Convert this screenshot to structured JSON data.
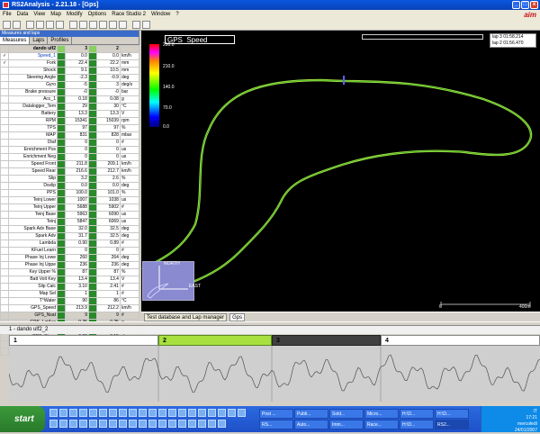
{
  "window": {
    "title": "RS2Analysis  -  2.21.18  -  [Gps]",
    "min": "_",
    "max": "□",
    "close": "x"
  },
  "menu": [
    "File",
    "Data",
    "View",
    "Map",
    "Modify",
    "Options",
    "Race Studio 2",
    "Window",
    "?"
  ],
  "brand": "aim",
  "left_panel": {
    "header": "Measures and laps",
    "tabs": [
      "Measures",
      "Laps",
      "Profiles"
    ],
    "columns": {
      "name": "dando ulf2",
      "lap_a": "3",
      "lap_b": "2"
    },
    "rows": [
      {
        "check": "✓",
        "name": "Speed_1",
        "a": "0.0",
        "b": "0.0",
        "unit": "km/h"
      },
      {
        "check": "✓",
        "name": "Fork",
        "a": "22.4",
        "b": "22.2",
        "unit": "mm"
      },
      {
        "check": "",
        "name": "Shock",
        "a": "9.1",
        "b": "10.5",
        "unit": "mm"
      },
      {
        "check": "",
        "name": "Steering Angle",
        "a": "-2.3",
        "b": "-0.9",
        "unit": "deg"
      },
      {
        "check": "",
        "name": "Gyro",
        "a": "-5",
        "b": "3",
        "unit": "deg/s"
      },
      {
        "check": "",
        "name": "Brake pressure",
        "a": "-0",
        "b": "-0",
        "unit": "bar"
      },
      {
        "check": "",
        "name": "Acc_1",
        "a": "0.18",
        "b": "0.08",
        "unit": "g"
      },
      {
        "check": "",
        "name": "Datalogger_Tem",
        "a": "29",
        "b": "30",
        "unit": "°C"
      },
      {
        "check": "",
        "name": "Battery",
        "a": "13.3",
        "b": "13.3",
        "unit": "V"
      },
      {
        "check": "",
        "name": "RPM",
        "a": "15341",
        "b": "15039",
        "unit": "rpm"
      },
      {
        "check": "",
        "name": "TPS",
        "a": "97",
        "b": "97",
        "unit": "%"
      },
      {
        "check": "",
        "name": "MAP",
        "a": "831",
        "b": "828",
        "unit": "mbar"
      },
      {
        "check": "",
        "name": "Dtaf",
        "a": "0",
        "b": "0",
        "unit": "#"
      },
      {
        "check": "",
        "name": "Enrichment Pos",
        "a": "0",
        "b": "0",
        "unit": "us"
      },
      {
        "check": "",
        "name": "Enrichment Neg",
        "a": "0",
        "b": "0",
        "unit": "us"
      },
      {
        "check": "",
        "name": "Speed Front",
        "a": "211.8",
        "b": "209.1",
        "unit": "km/h"
      },
      {
        "check": "",
        "name": "Speed Rear",
        "a": "216.6",
        "b": "212.7",
        "unit": "km/h"
      },
      {
        "check": "",
        "name": "Slip",
        "a": "3.2",
        "b": "2.6",
        "unit": "%"
      },
      {
        "check": "",
        "name": "Dsslip",
        "a": "0.0",
        "b": "0.0",
        "unit": "deg"
      },
      {
        "check": "",
        "name": "PPS",
        "a": "100.0",
        "b": "101.0",
        "unit": "%"
      },
      {
        "check": "",
        "name": "Teinj Lower",
        "a": "1007",
        "b": "1038",
        "unit": "us"
      },
      {
        "check": "",
        "name": "Teinj Upper",
        "a": "5688",
        "b": "5902",
        "unit": "#"
      },
      {
        "check": "",
        "name": "Teinj Base",
        "a": "5963",
        "b": "6090",
        "unit": "us"
      },
      {
        "check": "",
        "name": "Teinj",
        "a": "5847",
        "b": "6069",
        "unit": "us"
      },
      {
        "check": "",
        "name": "Spark Adv Base",
        "a": "32.0",
        "b": "32.5",
        "unit": "deg"
      },
      {
        "check": "",
        "name": "Spark Adv",
        "a": "31.7",
        "b": "32.5",
        "unit": "deg"
      },
      {
        "check": "",
        "name": "Lambda",
        "a": "0.90",
        "b": "0.89",
        "unit": "#"
      },
      {
        "check": "",
        "name": "KFuel Learn",
        "a": "0",
        "b": "0",
        "unit": "#"
      },
      {
        "check": "",
        "name": "Phase Inj Lowe",
        "a": "260",
        "b": "264",
        "unit": "deg"
      },
      {
        "check": "",
        "name": "Phase Inj Uppe",
        "a": "236",
        "b": "236",
        "unit": "deg"
      },
      {
        "check": "",
        "name": "Key Upper %",
        "a": "87",
        "b": "87",
        "unit": "%"
      },
      {
        "check": "",
        "name": "Batt Volt Key",
        "a": "13.4",
        "b": "13.4",
        "unit": "V"
      },
      {
        "check": "",
        "name": "Slip Calc",
        "a": "3.10",
        "b": "2.41",
        "unit": "#"
      },
      {
        "check": "",
        "name": "Map Sel",
        "a": "1",
        "b": "1",
        "unit": "#"
      },
      {
        "check": "",
        "name": "T°Water",
        "a": "90",
        "b": "86",
        "unit": "°C"
      },
      {
        "check": "",
        "name": "GPS_Speed",
        "a": "213.9",
        "b": "212.2",
        "unit": "km/h"
      },
      {
        "check": "",
        "name": "GPS_Nsat",
        "a": "9",
        "b": "9",
        "unit": "#"
      },
      {
        "check": "",
        "name": "GPS_LatAcc",
        "a": "-0.25",
        "b": "-0.25",
        "unit": "g"
      },
      {
        "check": "",
        "name": "GPS_LonAcc",
        "a": "0.26",
        "b": "0.29",
        "unit": "g"
      },
      {
        "check": "",
        "name": "GPS_Slope",
        "a": "0.20",
        "b": "0.15",
        "unit": "deg"
      },
      {
        "check": "",
        "name": "GPS_Heading",
        "a": "80.1",
        "b": "80.1",
        "unit": "deg"
      },
      {
        "check": "",
        "name": "GPS_YawRate",
        "a": "2.4",
        "b": "2.4",
        "unit": "deg/s"
      }
    ]
  },
  "map": {
    "title": "GPS_Speed",
    "scale_labels": [
      "280.0",
      "210.0",
      "140.0",
      "70.0",
      "0.0"
    ],
    "laps": [
      "lap 3 01:58.214",
      "lap 2 01:56.470"
    ],
    "compass": {
      "north": "NORTH",
      "east": "EAST"
    },
    "distance": {
      "start": "0",
      "end": "400m"
    },
    "track_color": "#a0e040"
  },
  "bottom_tabs": [
    "Test database and Lap manager",
    "Gps"
  ],
  "track": {
    "header": "1 - dando ulf2_2",
    "laps": [
      "1",
      "2",
      "3",
      "4"
    ]
  },
  "taskbar": {
    "start": "start",
    "tasks": [
      "Post ...",
      "Publi...",
      "Sold...",
      "Micro...",
      "H:\\D...",
      "H:\\D...",
      "RS...",
      "Auto...",
      "Imm...",
      "Race...",
      "H:\\D...",
      "RS2..."
    ],
    "lang": "IT",
    "clock": "17:21",
    "day": "mercoledì",
    "date": "24/01/2007"
  }
}
